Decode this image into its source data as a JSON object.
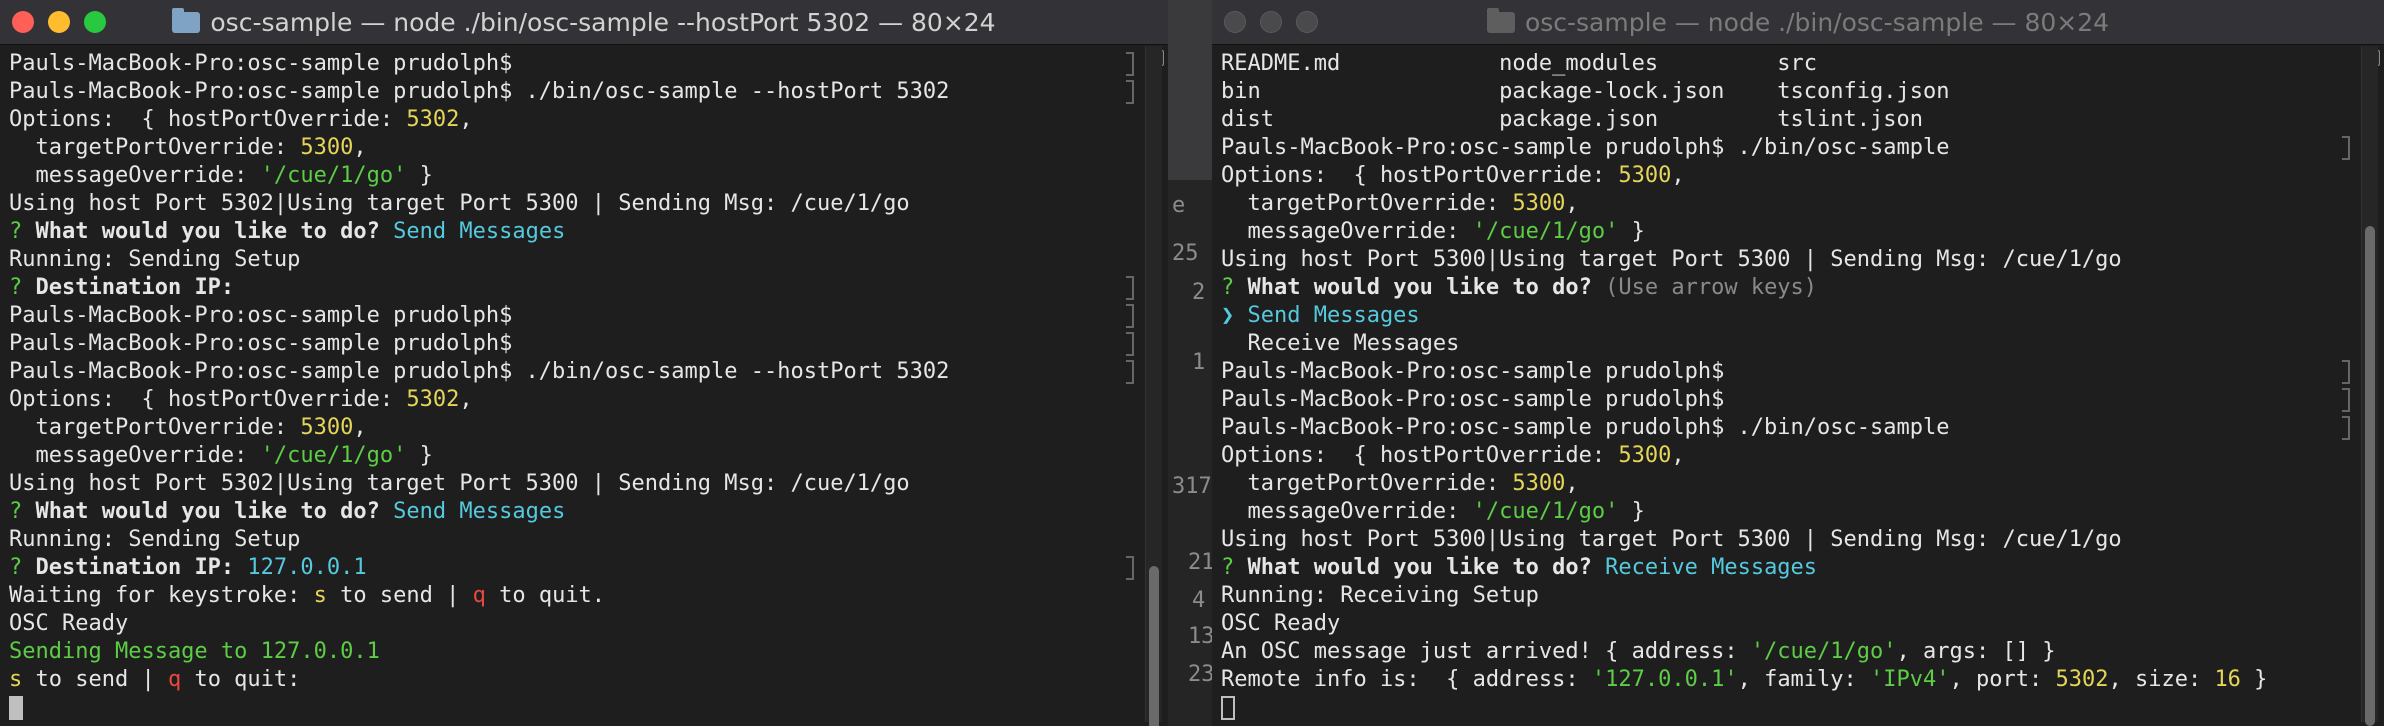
{
  "left_window": {
    "title": "osc-sample — node ./bin/osc-sample --hostPort 5302 — 80×24",
    "lines": [
      {
        "segs": [
          {
            "t": "Pauls-MacBook-Pro:osc-sample prudolph$ "
          }
        ],
        "mark": true
      },
      {
        "segs": [
          {
            "t": "Pauls-MacBook-Pro:osc-sample prudolph$ ./bin/osc-sample --hostPort 5302"
          }
        ],
        "mark": true
      },
      {
        "segs": [
          {
            "t": "Options:  { hostPortOverride: "
          },
          {
            "t": "5302",
            "c": "y"
          },
          {
            "t": ","
          }
        ]
      },
      {
        "segs": [
          {
            "t": "  targetPortOverride: "
          },
          {
            "t": "5300",
            "c": "y"
          },
          {
            "t": ","
          }
        ]
      },
      {
        "segs": [
          {
            "t": "  messageOverride: "
          },
          {
            "t": "'/cue/1/go'",
            "c": "g"
          },
          {
            "t": " }"
          }
        ]
      },
      {
        "segs": [
          {
            "t": "Using host Port 5302|Using target Port 5300 | Sending Msg: /cue/1/go"
          }
        ]
      },
      {
        "segs": [
          {
            "t": "? ",
            "c": "g"
          },
          {
            "t": "What would you like to do? ",
            "c": "b"
          },
          {
            "t": "Send Messages",
            "c": "c"
          }
        ]
      },
      {
        "segs": [
          {
            "t": "Running: Sending Setup"
          }
        ]
      },
      {
        "segs": [
          {
            "t": "? ",
            "c": "g"
          },
          {
            "t": "Destination IP:",
            "c": "b"
          }
        ],
        "mark": true
      },
      {
        "segs": [
          {
            "t": "Pauls-MacBook-Pro:osc-sample prudolph$ "
          }
        ],
        "mark": true
      },
      {
        "segs": [
          {
            "t": "Pauls-MacBook-Pro:osc-sample prudolph$ "
          }
        ],
        "mark": true
      },
      {
        "segs": [
          {
            "t": "Pauls-MacBook-Pro:osc-sample prudolph$ ./bin/osc-sample --hostPort 5302"
          }
        ],
        "mark": true
      },
      {
        "segs": [
          {
            "t": "Options:  { hostPortOverride: "
          },
          {
            "t": "5302",
            "c": "y"
          },
          {
            "t": ","
          }
        ]
      },
      {
        "segs": [
          {
            "t": "  targetPortOverride: "
          },
          {
            "t": "5300",
            "c": "y"
          },
          {
            "t": ","
          }
        ]
      },
      {
        "segs": [
          {
            "t": "  messageOverride: "
          },
          {
            "t": "'/cue/1/go'",
            "c": "g"
          },
          {
            "t": " }"
          }
        ]
      },
      {
        "segs": [
          {
            "t": "Using host Port 5302|Using target Port 5300 | Sending Msg: /cue/1/go"
          }
        ]
      },
      {
        "segs": [
          {
            "t": "? ",
            "c": "g"
          },
          {
            "t": "What would you like to do? ",
            "c": "b"
          },
          {
            "t": "Send Messages",
            "c": "c"
          }
        ]
      },
      {
        "segs": [
          {
            "t": "Running: Sending Setup"
          }
        ]
      },
      {
        "segs": [
          {
            "t": "? ",
            "c": "g"
          },
          {
            "t": "Destination IP: ",
            "c": "b"
          },
          {
            "t": "127.0.0.1",
            "c": "c"
          }
        ],
        "mark": true
      },
      {
        "segs": [
          {
            "t": "Waiting for keystroke: "
          },
          {
            "t": "s",
            "c": "y"
          },
          {
            "t": " to send | "
          },
          {
            "t": "q",
            "c": "r"
          },
          {
            "t": " to quit."
          }
        ]
      },
      {
        "segs": [
          {
            "t": "OSC Ready"
          }
        ]
      },
      {
        "segs": [
          {
            "t": "Sending Message to 127.0.0.1",
            "c": "g"
          }
        ]
      },
      {
        "segs": [
          {
            "t": "s",
            "c": "y"
          },
          {
            "t": " to send | "
          },
          {
            "t": "q",
            "c": "r"
          },
          {
            "t": " to quit:"
          }
        ]
      },
      {
        "segs": [],
        "cursor": "solid"
      }
    ]
  },
  "right_window": {
    "title": "osc-sample — node ./bin/osc-sample — 80×24",
    "lines": [
      {
        "segs": [
          {
            "t": "README.md            node_modules         src"
          }
        ]
      },
      {
        "segs": [
          {
            "t": "bin                  package-lock.json    tsconfig.json"
          }
        ]
      },
      {
        "segs": [
          {
            "t": "dist                 package.json         tslint.json"
          }
        ]
      },
      {
        "segs": [
          {
            "t": "Pauls-MacBook-Pro:osc-sample prudolph$ ./bin/osc-sample"
          }
        ],
        "mark": true
      },
      {
        "segs": [
          {
            "t": "Options:  { hostPortOverride: "
          },
          {
            "t": "5300",
            "c": "y"
          },
          {
            "t": ","
          }
        ]
      },
      {
        "segs": [
          {
            "t": "  targetPortOverride: "
          },
          {
            "t": "5300",
            "c": "y"
          },
          {
            "t": ","
          }
        ]
      },
      {
        "segs": [
          {
            "t": "  messageOverride: "
          },
          {
            "t": "'/cue/1/go'",
            "c": "g"
          },
          {
            "t": " }"
          }
        ]
      },
      {
        "segs": [
          {
            "t": "Using host Port 5300|Using target Port 5300 | Sending Msg: /cue/1/go"
          }
        ]
      },
      {
        "segs": [
          {
            "t": "? ",
            "c": "g"
          },
          {
            "t": "What would you like to do? ",
            "c": "b"
          },
          {
            "t": "(Use arrow keys)",
            "c": "dim"
          }
        ]
      },
      {
        "segs": [
          {
            "t": "❯ Send Messages",
            "c": "c"
          }
        ]
      },
      {
        "segs": [
          {
            "t": "  Receive Messages"
          }
        ]
      },
      {
        "segs": [
          {
            "t": "Pauls-MacBook-Pro:osc-sample prudolph$ "
          }
        ],
        "mark": true
      },
      {
        "segs": [
          {
            "t": "Pauls-MacBook-Pro:osc-sample prudolph$ "
          }
        ],
        "mark": true
      },
      {
        "segs": [
          {
            "t": "Pauls-MacBook-Pro:osc-sample prudolph$ ./bin/osc-sample"
          }
        ],
        "mark": true
      },
      {
        "segs": [
          {
            "t": "Options:  { hostPortOverride: "
          },
          {
            "t": "5300",
            "c": "y"
          },
          {
            "t": ","
          }
        ]
      },
      {
        "segs": [
          {
            "t": "  targetPortOverride: "
          },
          {
            "t": "5300",
            "c": "y"
          },
          {
            "t": ","
          }
        ]
      },
      {
        "segs": [
          {
            "t": "  messageOverride: "
          },
          {
            "t": "'/cue/1/go'",
            "c": "g"
          },
          {
            "t": " }"
          }
        ]
      },
      {
        "segs": [
          {
            "t": "Using host Port 5300|Using target Port 5300 | Sending Msg: /cue/1/go"
          }
        ]
      },
      {
        "segs": [
          {
            "t": "? ",
            "c": "g"
          },
          {
            "t": "What would you like to do? ",
            "c": "b"
          },
          {
            "t": "Receive Messages",
            "c": "c"
          }
        ]
      },
      {
        "segs": [
          {
            "t": "Running: Receiving Setup"
          }
        ]
      },
      {
        "segs": [
          {
            "t": "OSC Ready"
          }
        ]
      },
      {
        "segs": [
          {
            "t": "An OSC message just arrived! { address: "
          },
          {
            "t": "'/cue/1/go'",
            "c": "g"
          },
          {
            "t": ", args: [] }"
          }
        ]
      },
      {
        "segs": [
          {
            "t": "Remote info is:  { address: "
          },
          {
            "t": "'127.0.0.1'",
            "c": "g"
          },
          {
            "t": ", family: "
          },
          {
            "t": "'IPv4'",
            "c": "g"
          },
          {
            "t": ", port: "
          },
          {
            "t": "5302",
            "c": "y"
          },
          {
            "t": ", size: "
          },
          {
            "t": "16",
            "c": "y"
          },
          {
            "t": " }"
          }
        ]
      },
      {
        "segs": [],
        "cursor": "hollow"
      }
    ]
  },
  "background_fragments": [
    "e",
    "25",
    "2",
    "1",
    "317",
    "21",
    "4",
    "13",
    "23"
  ]
}
